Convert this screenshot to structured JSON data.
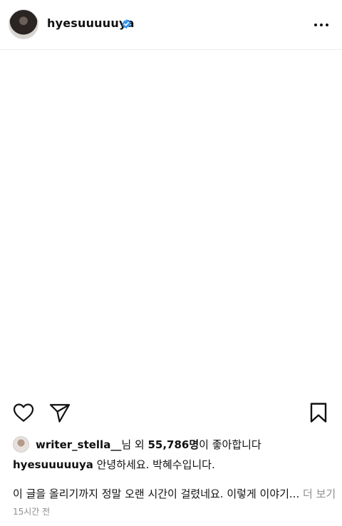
{
  "post": {
    "username": "hyesuuuuuya",
    "verified_icon": "verified-badge-icon",
    "more_icon": "more-options-icon"
  },
  "actions": {
    "like_icon": "heart-icon",
    "share_icon": "send-icon",
    "save_icon": "bookmark-icon"
  },
  "likes": {
    "first_liker": "writer_stella__",
    "connector": "님 외 ",
    "count": "55,786명",
    "suffix": "이 좋아합니다"
  },
  "caption": {
    "author": "hyesuuuuuya",
    "line1": " 안녕하세요. 박혜수입니다.",
    "line2": "이 글을 올리기까지 정말 오랜 시간이 걸렸네요. 이렇게 이야기... ",
    "more_label": "더 보기"
  },
  "timestamp": "15시간 전",
  "colors": {
    "verified": "#3897f0",
    "muted": "#8e8e8e",
    "text": "#111111"
  }
}
